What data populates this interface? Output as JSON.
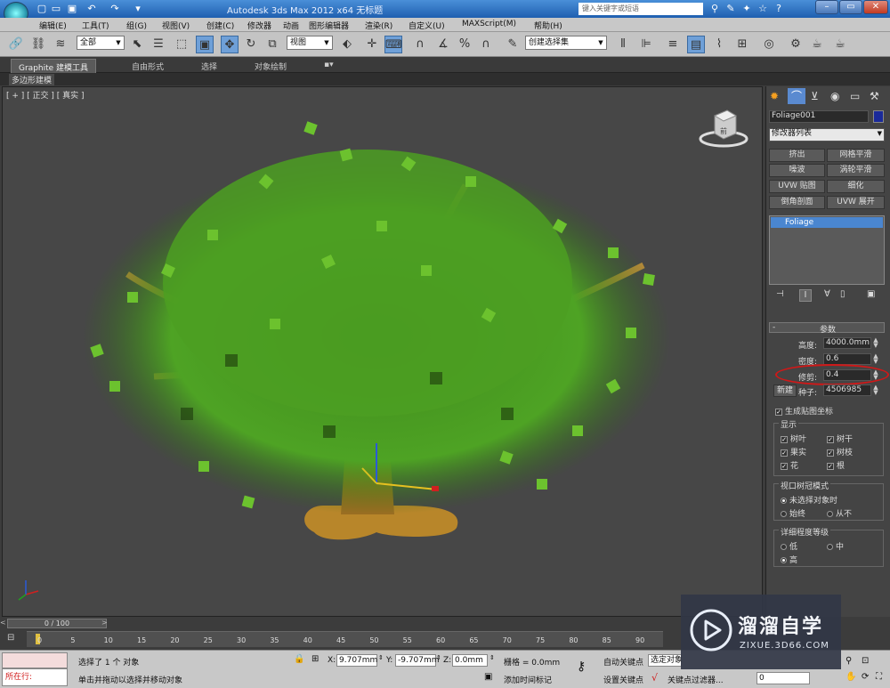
{
  "titlebar": {
    "title": "Autodesk 3ds Max  2012 x64    无标题",
    "search_placeholder": "键入关键字或短语"
  },
  "menu": [
    "编辑(E)",
    "工具(T)",
    "组(G)",
    "视图(V)",
    "创建(C)",
    "修改器",
    "动画",
    "图形编辑器",
    "渲染(R)",
    "自定义(U)",
    "MAXScript(M)",
    "帮助(H)"
  ],
  "toolbar": {
    "selection_filter": "全部",
    "reference_coord": "视图",
    "named_selection": "创建选择集"
  },
  "ribbon": {
    "tabs": [
      "Graphite 建模工具",
      "自由形式",
      "选择",
      "对象绘制"
    ],
    "sub_label": "多边形建模"
  },
  "viewport": {
    "label": "[ + ] [ 正交 ] [ 真实 ]",
    "cube_label": "前"
  },
  "command_panel": {
    "object_name": "Foliage001",
    "modifier_list": "修改器列表",
    "modifier_buttons": [
      "挤出",
      "网格平滑",
      "噪波",
      "涡轮平滑",
      "UVW 贴图",
      "细化",
      "倒角剖面",
      "UVW 展开"
    ],
    "stack_item": "Foliage",
    "rollout_title": "参数",
    "height_label": "高度:",
    "height_value": "4000.0mm",
    "density_label": "密度:",
    "density_value": "0.6",
    "prune_label": "修剪:",
    "prune_value": "0.4",
    "new_label": "新建",
    "seed_label": "种子:",
    "seed_value": "4506985",
    "gen_mapping_label": "生成贴图坐标",
    "display_group": "显示",
    "display_items": [
      "树叶",
      "树干",
      "果实",
      "树枝",
      "花",
      "根"
    ],
    "canopy_group": "视口树冠模式",
    "canopy_items": [
      "未选择对象时",
      "始终",
      "从不"
    ],
    "lod_group": "详细程度等级",
    "lod_items": [
      "低",
      "中",
      "高"
    ]
  },
  "timeline": {
    "frame_label": "0 / 100",
    "ticks": [
      "0",
      "5",
      "10",
      "15",
      "20",
      "25",
      "30",
      "35",
      "40",
      "45",
      "50",
      "55",
      "60",
      "65",
      "70",
      "75",
      "80",
      "85",
      "90"
    ]
  },
  "status": {
    "running_label": "所在行:",
    "selected_text": "选择了 1 个 对象",
    "prompt_text": "单击并拖动以选择并移动对象",
    "x_label": "X:",
    "x_value": "9.707mm",
    "y_label": "Y:",
    "y_value": "-9.707mm",
    "z_label": "Z:",
    "z_value": "0.0mm",
    "grid_text": "栅格 = 0.0mm",
    "add_time_tag": "添加时间标记",
    "auto_key": "自动关键点",
    "set_key": "设置关键点",
    "selected_object": "选定对象",
    "key_filters": "关键点过滤器...",
    "frame_value": "0"
  },
  "watermark": {
    "name": "溜溜自学",
    "url": "ZIXUE.3D66.COM"
  },
  "colors": {
    "highlight_red": "#d01818",
    "stack_blue": "#4a86d0",
    "leaf_green": "#5fb52a"
  }
}
